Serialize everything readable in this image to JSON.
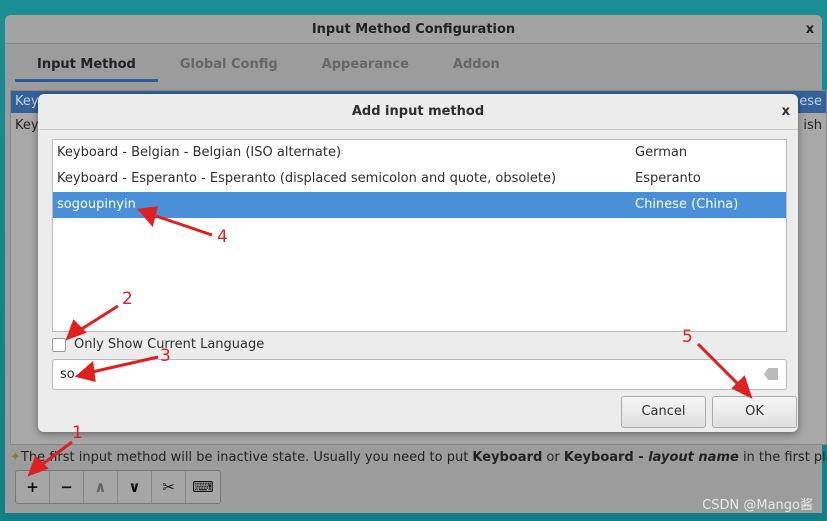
{
  "window": {
    "title": "Input Method Configuration",
    "close": "x",
    "tabs": [
      {
        "label": "Input Method",
        "active": true
      },
      {
        "label": "Global Config"
      },
      {
        "label": "Appearance"
      },
      {
        "label": "Addon"
      }
    ],
    "list_header": {
      "left": "Key",
      "right": "ese"
    },
    "list_row": {
      "left": "Key",
      "right": "ish"
    },
    "hint": {
      "pre": "The first input method will be inactive state. Usually you need to put ",
      "b1": "Keyboard",
      "mid": " or ",
      "b2": "Keyboard - ",
      "i": "layout name",
      "post": " in the first place."
    },
    "toolbar": [
      {
        "icon": "plus-icon",
        "glyph": "+"
      },
      {
        "icon": "minus-icon",
        "glyph": "−"
      },
      {
        "icon": "up-icon",
        "glyph": "∧"
      },
      {
        "icon": "down-icon",
        "glyph": "∨"
      },
      {
        "icon": "tools-icon",
        "glyph": "✂"
      },
      {
        "icon": "keyboard-icon",
        "glyph": "⌨"
      }
    ]
  },
  "dialog": {
    "title": "Add input method",
    "close": "x",
    "items": [
      {
        "name": "Keyboard - Belgian - Belgian (ISO alternate)",
        "lang": "German"
      },
      {
        "name": "Keyboard - Esperanto - Esperanto (displaced semicolon and quote, obsolete)",
        "lang": "Esperanto"
      },
      {
        "name": "sogoupinyin",
        "lang": "Chinese (China)",
        "selected": true
      }
    ],
    "only_current_language": {
      "label": "Only Show Current Language",
      "checked": false
    },
    "search_value": "so",
    "cancel": "Cancel",
    "ok": "OK"
  },
  "annotations": [
    "1",
    "2",
    "3",
    "4",
    "5"
  ],
  "annotation_color": "#e02020",
  "watermark": "CSDN @Mango酱"
}
